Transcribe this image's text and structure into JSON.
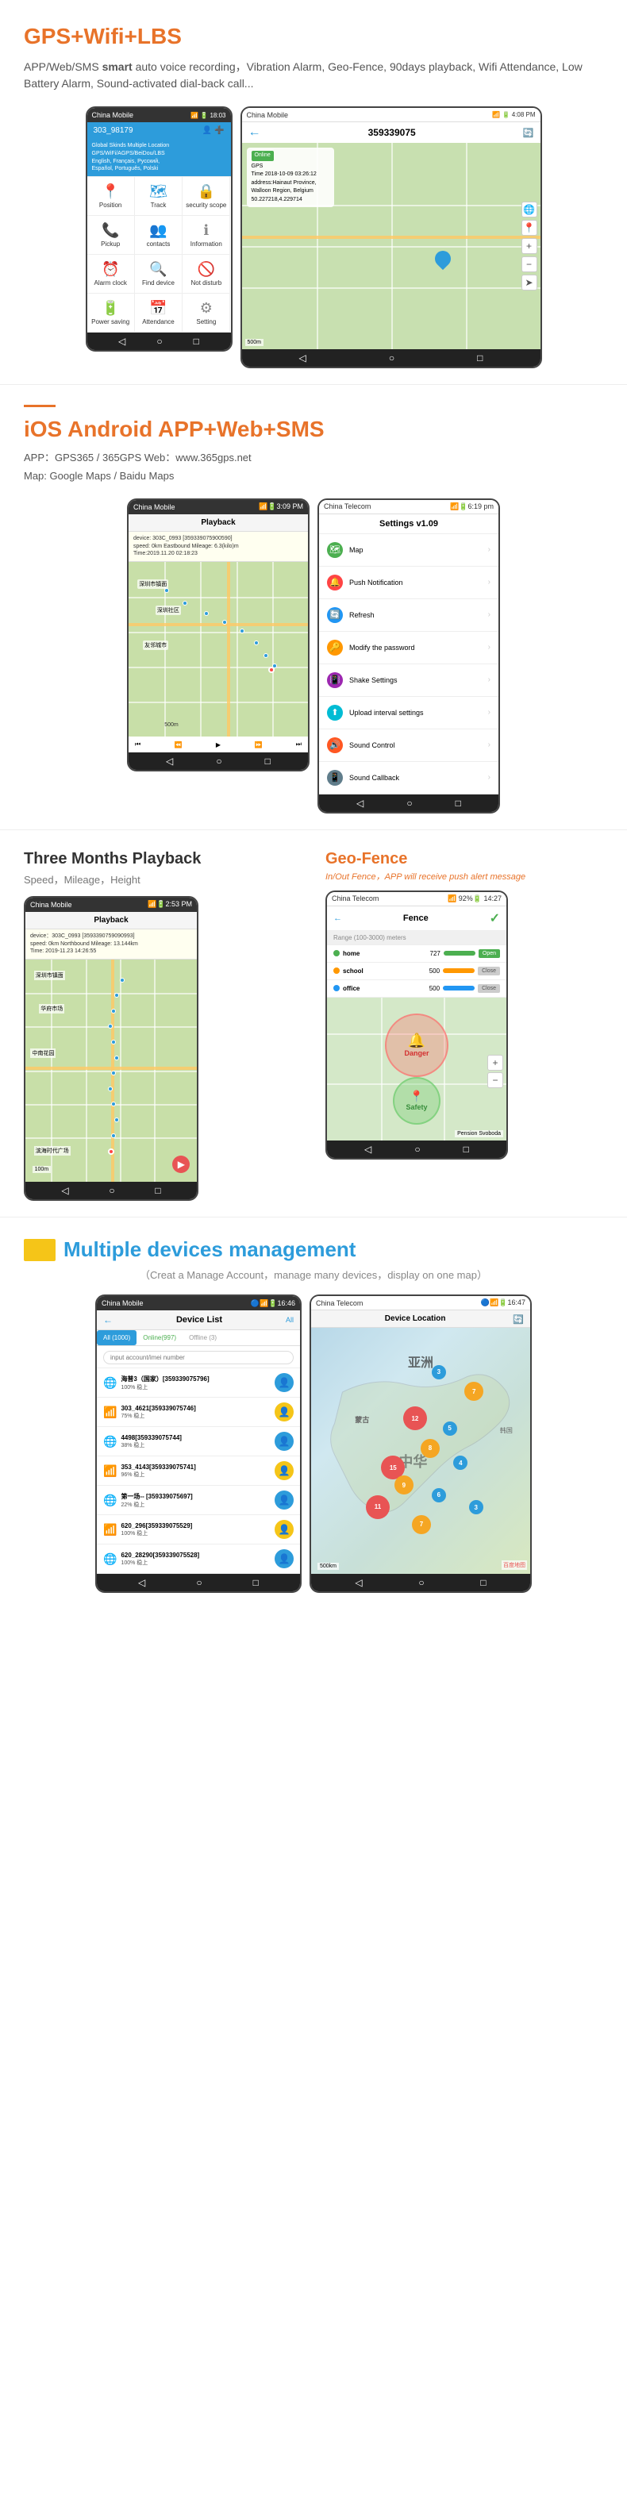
{
  "section1": {
    "title_prefix": "GPS",
    "title_accent": "+Wifi+LBS",
    "description": "APP/Web/SMS ",
    "description_strong": "smart",
    "description_rest": " auto voice recording，Vibration Alarm, Geo-Fence, 90days playback, Wifi Attendance, Low Battery Alarm, Sound-activated dial-back call...",
    "phone_left": {
      "carrier": "China Mobile",
      "time": "18:03",
      "phone_id": "303_98179",
      "banner_line1": "Global Skinds Multiple Location",
      "banner_line2": "GPS/WiFi/AGPS/BeiDou/LBS",
      "banner_line3": "English, Français, Pyccкий,",
      "banner_line4": "Español, Português, Polski",
      "menu_items": [
        {
          "icon": "📍",
          "label": "Position"
        },
        {
          "icon": "🗺",
          "label": "Track"
        },
        {
          "icon": "🔒",
          "label": "security scope"
        },
        {
          "icon": "📞",
          "label": "Pickup"
        },
        {
          "icon": "👥",
          "label": "contacts"
        },
        {
          "icon": "ℹ",
          "label": "Information"
        },
        {
          "icon": "⏰",
          "label": "Alarm clock"
        },
        {
          "icon": "🔍",
          "label": "Find device"
        },
        {
          "icon": "🚫",
          "label": "Not disturb"
        },
        {
          "icon": "🔋",
          "label": "Power saving"
        },
        {
          "icon": "📅",
          "label": "Attendance"
        },
        {
          "icon": "⚙",
          "label": "Setting"
        }
      ]
    },
    "phone_right": {
      "carrier": "China Mobile",
      "time": "4:08 PM",
      "phone_id": "359339075",
      "status": "Online",
      "status_type": "GPS",
      "time_info": "Time 2018-10-09 03:26:12",
      "address": "address:Hainaut Province, Walloon Region, Belgium 50.227218,4.229714"
    }
  },
  "section2": {
    "title_prefix": "iOS Android APP",
    "title_accent": "+Web+SMS",
    "app_line1": "APP：GPS365 / 365GPS    Web：www.365gps.net",
    "app_line2": "Map: Google Maps / Baidu Maps",
    "phone_settings": {
      "carrier": "China Telecom",
      "time": "6:19 pm",
      "header": "Settings v1.09",
      "items": [
        {
          "icon": "🗺",
          "icon_class": "s-icon-map",
          "label": "Map"
        },
        {
          "icon": "🔔",
          "icon_class": "s-icon-push",
          "label": "Push Notification"
        },
        {
          "icon": "🔄",
          "icon_class": "s-icon-refresh",
          "label": "Refresh"
        },
        {
          "icon": "🔑",
          "icon_class": "s-icon-password",
          "label": "Modify the password"
        },
        {
          "icon": "📳",
          "icon_class": "s-icon-shake",
          "label": "Shake Settings"
        },
        {
          "icon": "⬆",
          "icon_class": "s-icon-upload",
          "label": "Upload interval settings"
        },
        {
          "icon": "🔊",
          "icon_class": "s-icon-sound",
          "label": "Sound Control"
        },
        {
          "icon": "📱",
          "icon_class": "s-icon-callback",
          "label": "Sound Callback"
        }
      ]
    },
    "phone_playback": {
      "carrier": "China Mobile",
      "time": "3:09 PM",
      "header": "Playback",
      "device_line1": "device: 303C_0993 [359339075900590]",
      "device_line2": "speed: 0km  Eastbound Mileage: 6.3(kilo)m",
      "device_line3": "Time:2019.11.20 02:18:23"
    }
  },
  "section3": {
    "left_title": "Three Months Playback",
    "left_subtitle": "Speed，Mileage，Height",
    "phone_playback2": {
      "carrier": "China Mobile",
      "time": "2:53 PM",
      "header": "Playback",
      "device_line1": "device：303C_0993 [3593390759090993]",
      "device_line2": "speed: 0km  Northbound Mileage: 13.144km",
      "device_line3": "Time: 2019-11.23 14:26:55"
    },
    "right_title_prefix": "Geo-",
    "right_title_accent": "Fence",
    "right_desc": "In/Out Fence，APP will receive push alert message",
    "phone_fence": {
      "carrier": "China Telecom",
      "time": "14:27",
      "signal": "92%",
      "header": "Fence",
      "range_label": "Range (100-3000) meters",
      "rows": [
        {
          "dot_class": "fence-dot-home",
          "name": "home",
          "meters": "727",
          "btn_label": "Open",
          "btn_class": "btn-open"
        },
        {
          "dot_class": "fence-dot-school",
          "name": "school",
          "meters": "500",
          "btn_label": "Close",
          "btn_class": "btn-close"
        },
        {
          "dot_class": "fence-dot-office",
          "name": "office",
          "meters": "500",
          "btn_label": "Close",
          "btn_class": "btn-close"
        }
      ],
      "danger_label": "Danger",
      "safety_label": "Safety"
    }
  },
  "section4": {
    "title_prefix": "Multiple devices ",
    "title_accent": "management",
    "desc": "（Creat a Manage Account，manage many devices，display on one map）",
    "phone_list": {
      "carrier": "China Mobile",
      "time": "16:46",
      "header": "Device List",
      "all_label": "All",
      "tabs": [
        "All (1000)",
        "Online(997)",
        "Offline (3)"
      ],
      "search_placeholder": "input account/imei number",
      "devices": [
        {
          "globe": "🌐",
          "name": "海普3（国家）[359339075796]",
          "id": "",
          "status": "100% 稳上"
        },
        {
          "globe": "📶",
          "name": "303_4621[359339075746]",
          "id": "",
          "status": "75% 稳上"
        },
        {
          "globe": "🌐",
          "name": "4498[359339075744]",
          "id": "",
          "status": "38% 稳上"
        },
        {
          "globe": "📶",
          "name": "353_4143[359339075741]",
          "id": "",
          "status": "96% 稳上"
        },
        {
          "globe": "🌐",
          "name": "第一场-- [359339075697]",
          "id": "",
          "status": "22% 稳上"
        },
        {
          "globe": "📶",
          "name": "620_296[359339075529]",
          "id": "",
          "status": "100% 稳上"
        },
        {
          "globe": "🌐",
          "name": "620_28290[359339075528]",
          "id": "",
          "status": "100% 稳上"
        }
      ]
    },
    "phone_location": {
      "carrier": "China Telecom",
      "time": "16:47",
      "header": "Device Location",
      "labels": [
        "亚洲",
        "中华"
      ],
      "clusters": [
        {
          "x": "55%",
          "y": "15%",
          "count": "3",
          "size": "cluster-sm"
        },
        {
          "x": "70%",
          "y": "25%",
          "count": "7",
          "size": "cluster-md"
        },
        {
          "x": "45%",
          "y": "35%",
          "count": "12",
          "size": "cluster-lg"
        },
        {
          "x": "60%",
          "y": "40%",
          "count": "5",
          "size": "cluster-sm"
        },
        {
          "x": "50%",
          "y": "50%",
          "count": "8",
          "size": "cluster-md"
        },
        {
          "x": "35%",
          "y": "55%",
          "count": "15",
          "size": "cluster-lg"
        },
        {
          "x": "65%",
          "y": "55%",
          "count": "4",
          "size": "cluster-sm"
        },
        {
          "x": "40%",
          "y": "65%",
          "count": "9",
          "size": "cluster-md"
        },
        {
          "x": "55%",
          "y": "68%",
          "count": "6",
          "size": "cluster-sm"
        },
        {
          "x": "30%",
          "y": "70%",
          "count": "11",
          "size": "cluster-lg"
        },
        {
          "x": "70%",
          "y": "72%",
          "count": "3",
          "size": "cluster-sm"
        },
        {
          "x": "48%",
          "y": "78%",
          "count": "7",
          "size": "cluster-md"
        }
      ]
    }
  }
}
